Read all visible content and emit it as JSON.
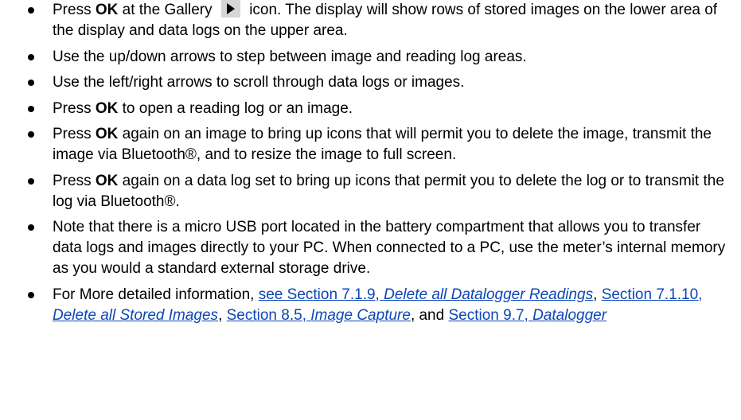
{
  "bullets": {
    "b1": {
      "pre": "Press ",
      "bold": "OK",
      "mid": " at the Gallery ",
      "icon": "play-icon",
      "post": " icon. The display will show rows of stored images on the lower area of the display and data logs on the upper area."
    },
    "b2": {
      "text": "Use the up/down arrows to step between image and reading log areas."
    },
    "b3": {
      "text": "Use the left/right arrows to scroll through data logs or images."
    },
    "b4": {
      "pre": "Press ",
      "bold": "OK",
      "post": " to open a reading log or an image."
    },
    "b5": {
      "pre": "Press ",
      "bold": "OK",
      "post": " again on an image to bring up icons that will permit you to delete the image, transmit the image via Bluetooth®, and to resize the image to full screen."
    },
    "b6": {
      "pre": "Press ",
      "bold": "OK",
      "post": " again on a data log set to bring up icons that permit you to delete the log or to transmit the log via Bluetooth®."
    },
    "b7": {
      "text": "Note that there is a micro USB port located in the battery compartment that allows you to transfer data logs and images directly to your PC. When connected to a PC, use the meter’s internal memory as you would a standard external storage drive."
    },
    "b8": {
      "pre": "For More detailed information, ",
      "link1": {
        "pre": "see Section 7.1.9, ",
        "italic": "Delete all Datalogger Readings"
      },
      "sep1": ", ",
      "link2": {
        "pre": "Section 7.1.10, ",
        "italic": "Delete all Stored Images"
      },
      "sep2": ", ",
      "link3": {
        "pre": "Section 8.5, ",
        "italic": "Image Capture"
      },
      "sep3": ", and ",
      "link4": {
        "pre": "Section 9.7, ",
        "italic": "Datalogger"
      }
    }
  },
  "colors": {
    "link": "#0b46b8",
    "icon_bg": "#d6d6d6"
  }
}
